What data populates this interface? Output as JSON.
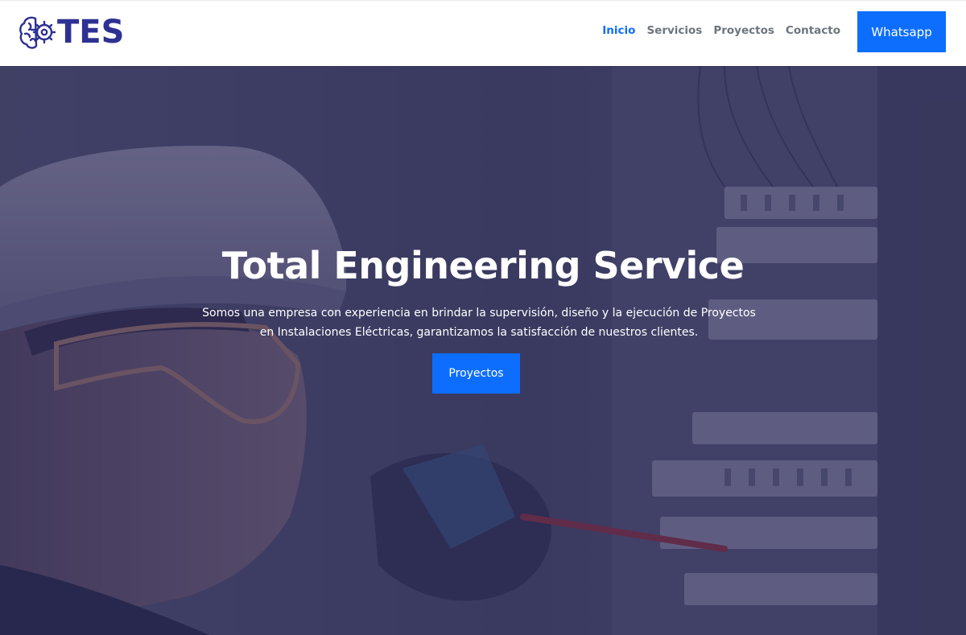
{
  "brand": {
    "logo_text": "TES",
    "icon": "brain-gear-icon",
    "color": "#2e3192"
  },
  "nav": {
    "items": [
      {
        "label": "Inicio",
        "active": true
      },
      {
        "label": "Servicios",
        "active": false
      },
      {
        "label": "Proyectos",
        "active": false
      },
      {
        "label": "Contacto",
        "active": false
      }
    ],
    "cta_label": "Whatsapp"
  },
  "hero": {
    "title": "Total Engineering Service",
    "description": "Somos una empresa con experiencia en brindar la supervisión, diseño y la ejecución de Proyectos en Instalaciones Eléctricas, garantizamos la satisfacción de nuestros clientes.",
    "button_label": "Proyectos",
    "background": "electrician-hardhat-photo"
  },
  "colors": {
    "accent": "#0d6efd",
    "nav_text": "#6c757d",
    "overlay": "#262452"
  }
}
